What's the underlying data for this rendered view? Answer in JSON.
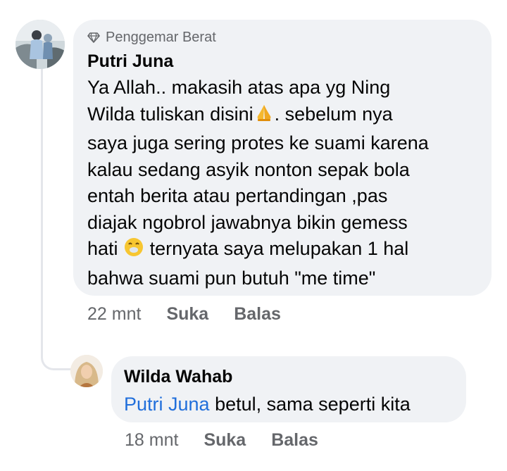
{
  "comment": {
    "badge": "Penggemar Berat",
    "badge_icon": "diamond-icon",
    "author": "Putri Juna",
    "lines": [
      "Ya Allah.. makasih atas apa yg Ning",
      "Wilda tuliskan disini",
      ". sebelum nya",
      "saya juga sering protes ke suami karena",
      "kalau sedang asyik nonton sepak bola",
      "entah berita atau pertandingan ,pas",
      "diajak ngobrol jawabnya bikin gemess",
      "hati",
      "ternyata saya melupakan 1 hal",
      "bahwa suami pun butuh \"me time\""
    ],
    "time": "22 mnt",
    "like_label": "Suka",
    "reply_label": "Balas"
  },
  "reply": {
    "author": "Wilda Wahab",
    "mention": "Putri Juna",
    "text": " betul, sama seperti kita",
    "time": "18 mnt",
    "like_label": "Suka",
    "reply_label": "Balas"
  },
  "colors": {
    "bubble": "#f0f2f5",
    "mention": "#216fdb",
    "secondary_text": "#65676b"
  }
}
